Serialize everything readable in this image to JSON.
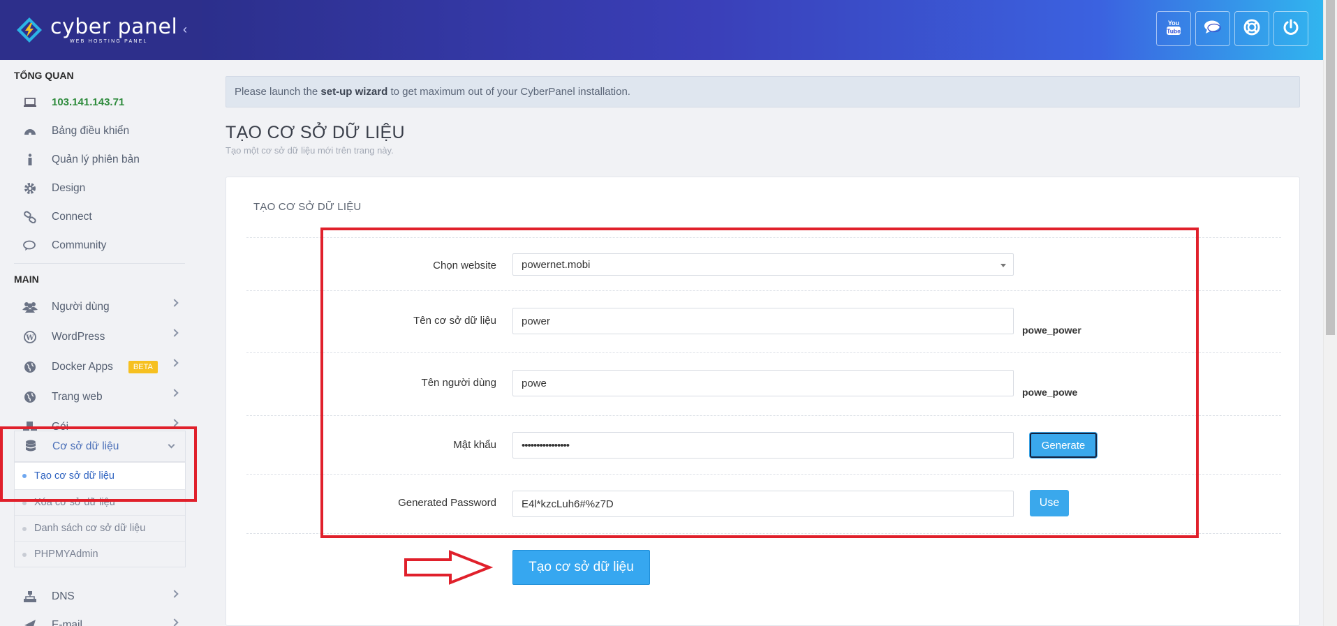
{
  "brand": {
    "name": "cyber panel",
    "tagline": "WEB HOSTING PANEL"
  },
  "sidebar": {
    "section_overview": "TỔNG QUAN",
    "overview_items": [
      {
        "label": "103.141.143.71",
        "icon": "laptop-icon"
      },
      {
        "label": "Bảng điều khiển",
        "icon": "dashboard-icon"
      },
      {
        "label": "Quản lý phiên bản",
        "icon": "info-icon"
      },
      {
        "label": "Design",
        "icon": "gear-icon"
      },
      {
        "label": "Connect",
        "icon": "link-icon"
      },
      {
        "label": "Community",
        "icon": "chat-icon"
      }
    ],
    "section_main": "MAIN",
    "main_items": [
      {
        "label": "Người dùng",
        "icon": "users-icon"
      },
      {
        "label": "WordPress",
        "icon": "wordpress-icon"
      },
      {
        "label": "Docker Apps",
        "icon": "globe-icon",
        "badge": "BETA"
      },
      {
        "label": "Trang web",
        "icon": "globe-icon"
      },
      {
        "label": "Gói",
        "icon": "cubes-icon"
      }
    ],
    "database": {
      "label": "Cơ sở dữ liệu",
      "sub_items": [
        {
          "label": "Tạo cơ sở dữ liệu",
          "active": true
        },
        {
          "label": "Xóa cơ sở dữ liệu"
        },
        {
          "label": "Danh sách cơ sở dữ liệu"
        },
        {
          "label": "PHPMYAdmin"
        }
      ]
    },
    "after_items": [
      {
        "label": "DNS",
        "icon": "sitemap-icon"
      },
      {
        "label": "E-mail",
        "icon": "send-icon"
      }
    ]
  },
  "header": {
    "buttons": [
      {
        "name": "youtube-icon"
      },
      {
        "name": "chat-icon"
      },
      {
        "name": "support-icon"
      },
      {
        "name": "power-icon"
      }
    ]
  },
  "notice": {
    "prefix": "Please launch the ",
    "link": "set-up wizard",
    "suffix": " to get maximum out of your CyberPanel installation."
  },
  "page": {
    "title": "TẠO CƠ SỞ DỮ LIỆU",
    "subtitle": "Tạo một cơ sở dữ liệu mới trên trang này."
  },
  "form": {
    "card_title": "TẠO CƠ SỞ DỮ LIỆU",
    "website_label": "Chọn website",
    "website_value": "powernet.mobi",
    "dbname_label": "Tên cơ sở dữ liệu",
    "dbname_value": "power",
    "dbname_suffix": "powe_power",
    "username_label": "Tên người dùng",
    "username_value": "powe",
    "username_suffix": "powe_powe",
    "password_label": "Mật khẩu",
    "password_value": "••••••••••••••••",
    "generate_label": "Generate",
    "generated_label": "Generated Password",
    "generated_value": "E4l*kzcLuh6#%z7D",
    "use_label": "Use",
    "submit_label": "Tạo cơ sở dữ liệu"
  },
  "colors": {
    "annotation": "#e0202b",
    "primary": "#36a7f0",
    "header_start": "#2c2f8c",
    "header_end": "#31b5ef"
  }
}
